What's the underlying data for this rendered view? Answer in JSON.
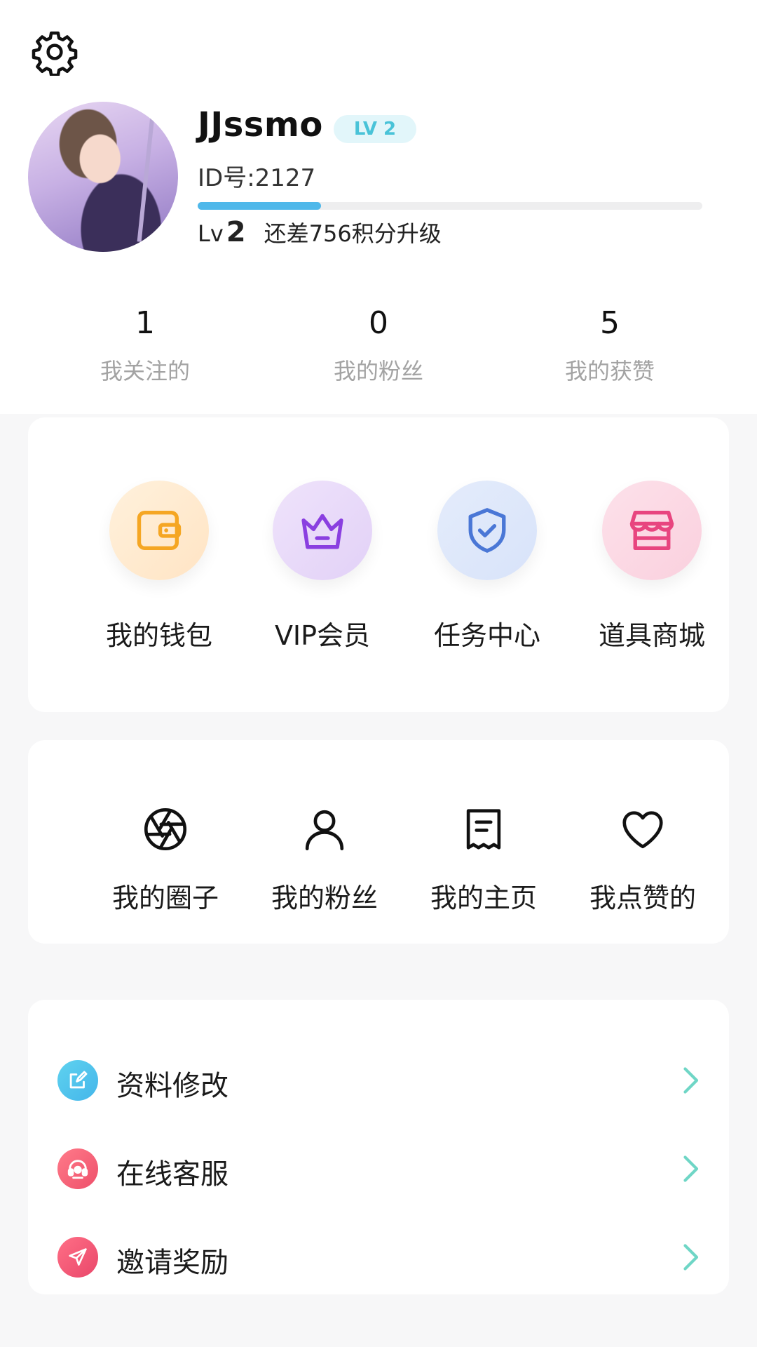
{
  "profile": {
    "username": "JJssmo",
    "level_badge": "LV 2",
    "id_text": "ID号:2127",
    "level_prefix": "Lv",
    "level_number": "2",
    "upgrade_text": "还差756积分升级",
    "progress_fraction": 0.245
  },
  "stats": [
    {
      "value": "1",
      "label": "我关注的"
    },
    {
      "value": "0",
      "label": "我的粉丝"
    },
    {
      "value": "5",
      "label": "我的获赞"
    }
  ],
  "features": [
    {
      "label": "我的钱包",
      "icon": "wallet-icon"
    },
    {
      "label": "VIP会员",
      "icon": "crown-icon"
    },
    {
      "label": "任务中心",
      "icon": "shield-check-icon"
    },
    {
      "label": "道具商城",
      "icon": "store-icon"
    }
  ],
  "quick_links": [
    {
      "label": "我的圈子",
      "icon": "aperture-icon"
    },
    {
      "label": "我的粉丝",
      "icon": "person-icon"
    },
    {
      "label": "我的主页",
      "icon": "document-icon"
    },
    {
      "label": "我点赞的",
      "icon": "heart-icon"
    }
  ],
  "menu": [
    {
      "label": "资料修改",
      "icon": "edit-icon"
    },
    {
      "label": "在线客服",
      "icon": "headset-icon"
    },
    {
      "label": "邀请奖励",
      "icon": "send-icon"
    }
  ],
  "colors": {
    "progress": "#4fb8ea",
    "badge_bg": "#e2f6fa",
    "badge_text": "#49c3d8",
    "chevron": "#6fd6c6"
  }
}
